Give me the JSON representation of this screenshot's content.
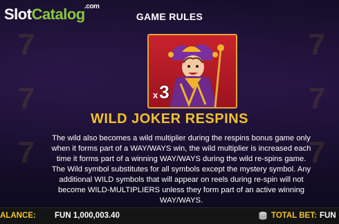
{
  "header": {
    "logo_slot": "Slot",
    "logo_catalog": "Catalog",
    "logo_com": ".com",
    "title": "GAME RULES"
  },
  "symbol": {
    "name": "wild-joker",
    "multiplier_prefix": "x",
    "multiplier_value": "3"
  },
  "section": {
    "title": "WILD JOKER RESPINS",
    "lines": [
      "The wild also becomes a wild multiplier during the respins bonus game only",
      "when it forms part of a WAY/WAYS win, the wild multiplier is increased each",
      "time it forms part of a winning WAY/WAYS during the wild re-spins game.",
      "The Wild symbol substitutes for all symbols except the mystery symbol. Any",
      "additional WILD symbols that will appear on reels during re-spin will not",
      "become WILD-MULTIPLIERS unless they form part of an active winning",
      "WAY/WAYS."
    ]
  },
  "footer": {
    "balance_label": "ALANCE:",
    "balance_value": "FUN 1,000,003.40",
    "bet_label": "TOTAL BET:",
    "bet_value": "FUN"
  },
  "colors": {
    "accent_gold": "#f2c12e",
    "logo_green": "#8bc53f",
    "symbol_red": "#c9222c"
  }
}
